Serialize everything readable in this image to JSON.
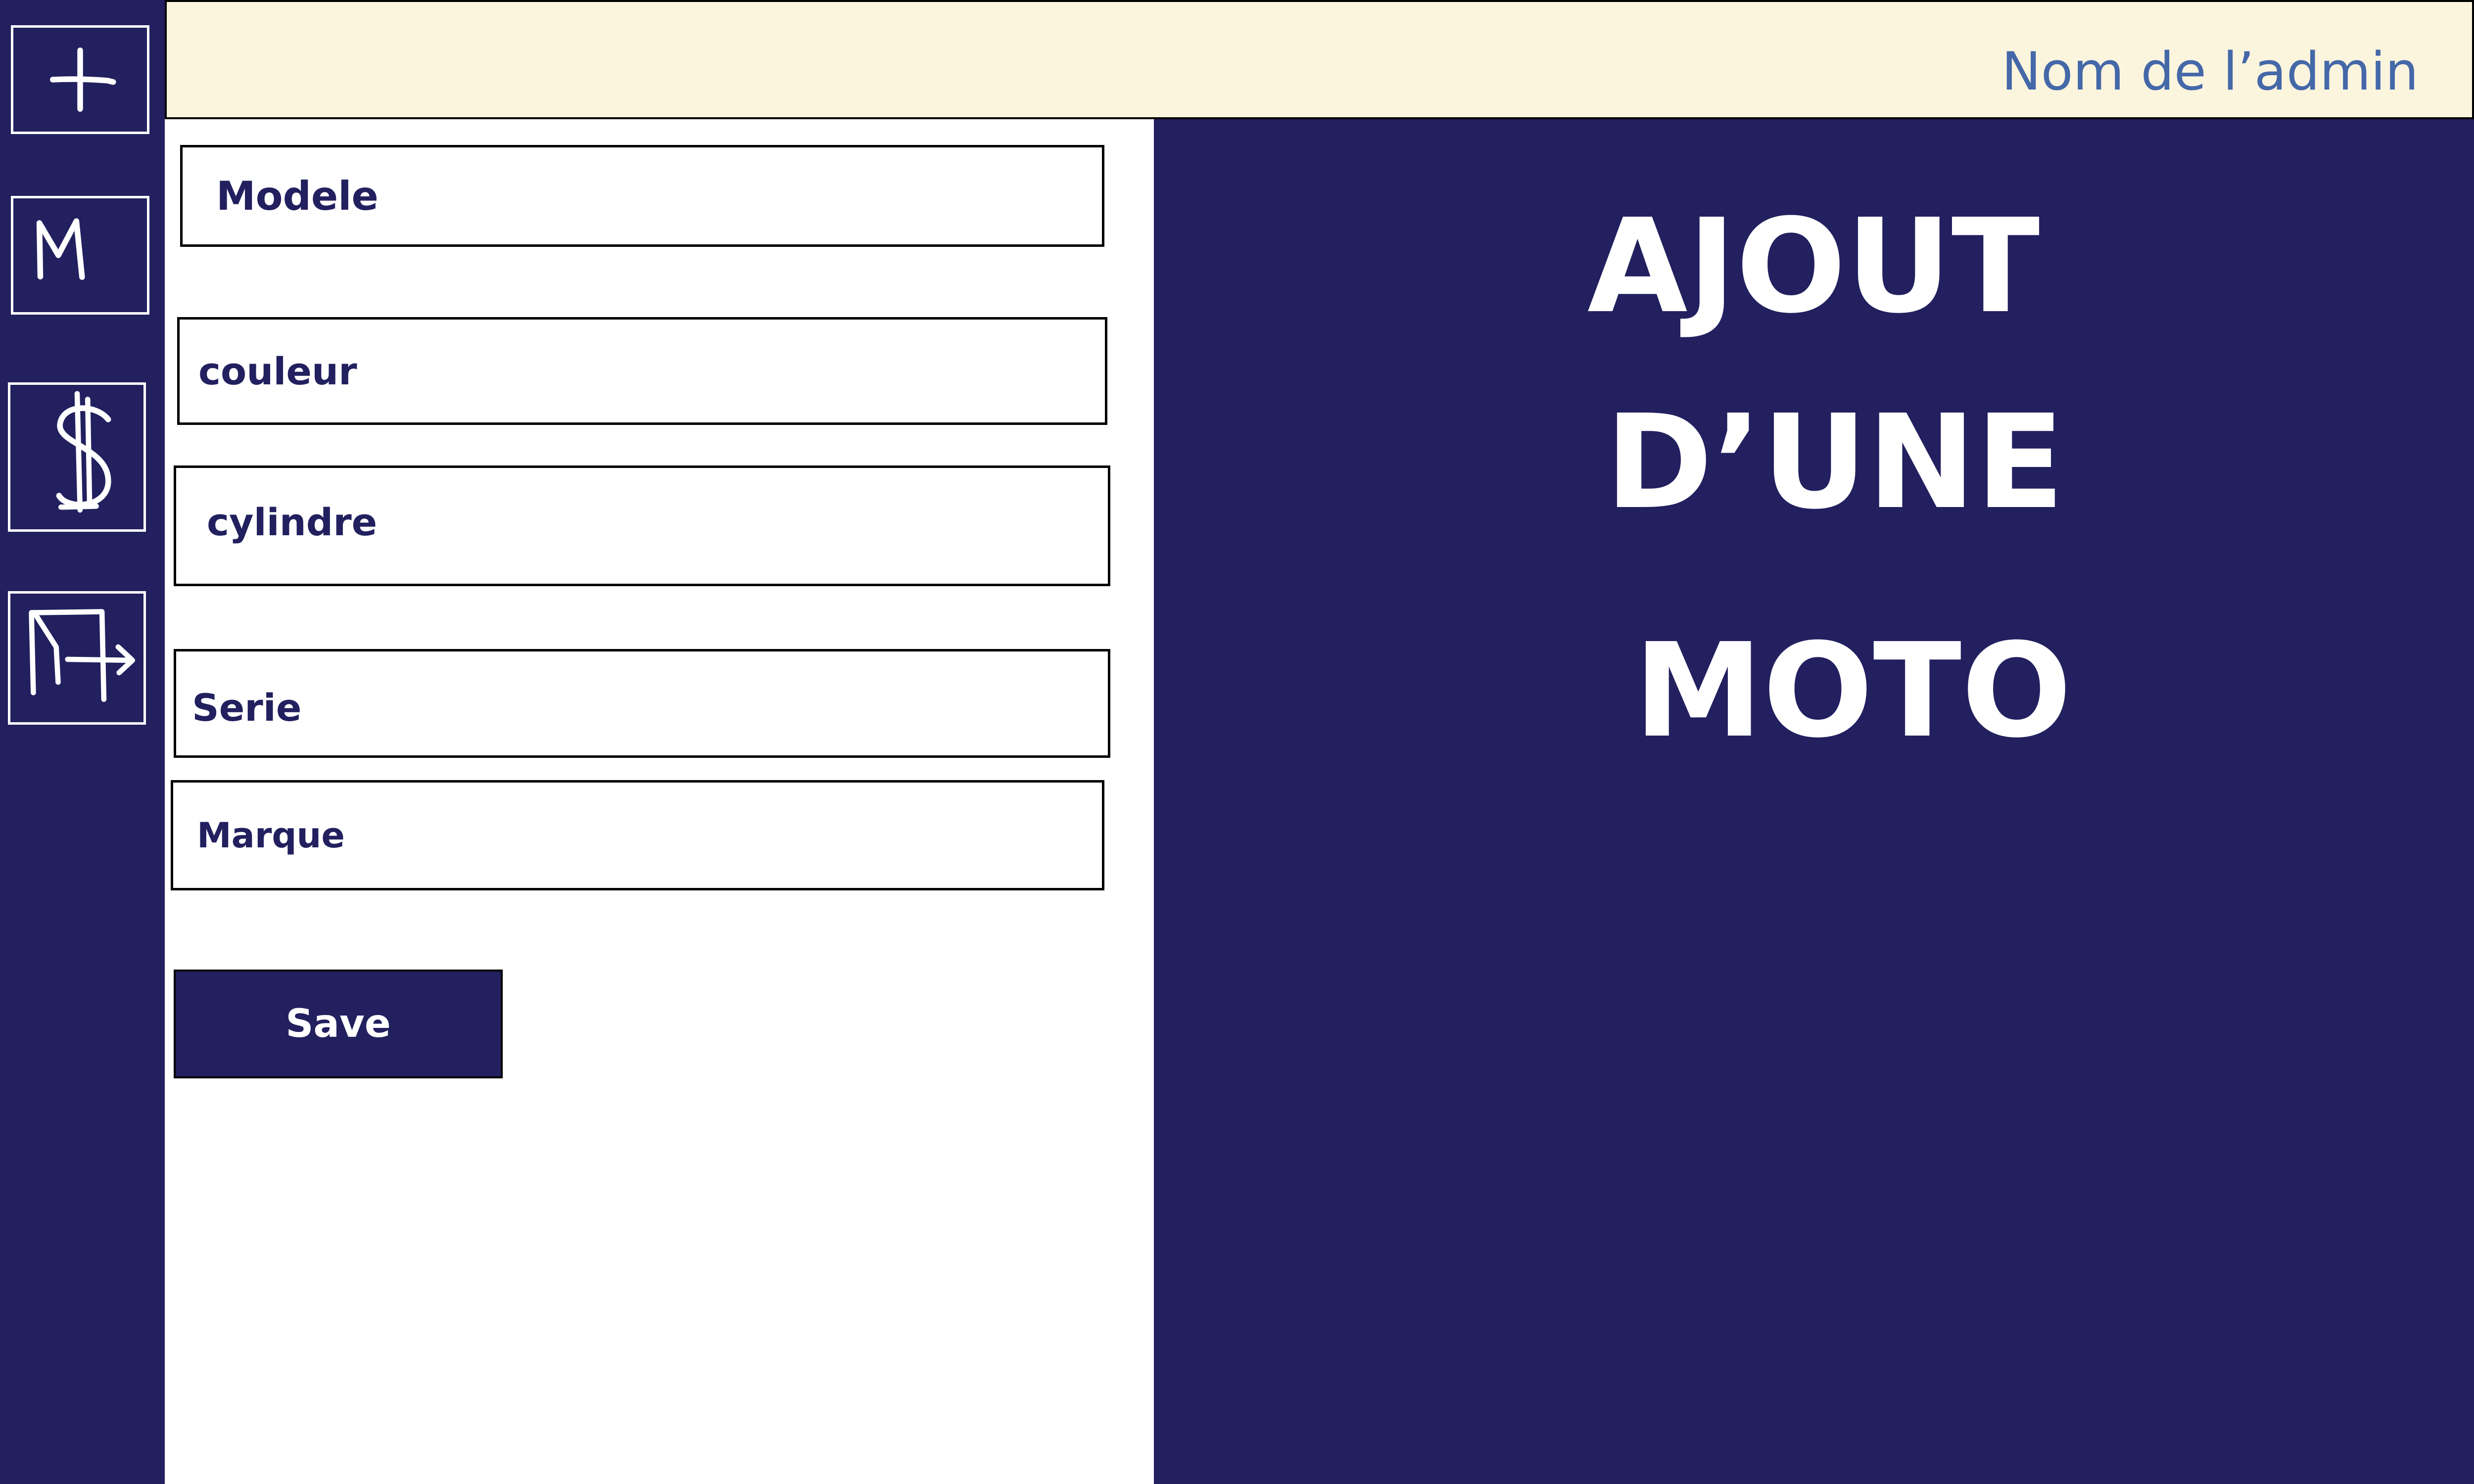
{
  "sidebar": {
    "items": [
      {
        "name": "add",
        "icon": "plus-icon"
      },
      {
        "name": "models",
        "icon": "letter-m-icon"
      },
      {
        "name": "price",
        "icon": "dollar-icon"
      },
      {
        "name": "logout",
        "icon": "logout-icon"
      }
    ]
  },
  "header": {
    "admin_name": "Nom de l’admin"
  },
  "form": {
    "modele_placeholder": "Modele",
    "couleur_placeholder": "couleur",
    "cylindre_placeholder": "cylindre",
    "serie_placeholder": "Serie",
    "marque_placeholder": "Marque",
    "save_label": "Save"
  },
  "hero": {
    "line1": "AJOUT",
    "line2": "D’UNE",
    "line3": "MOTO"
  },
  "colors": {
    "primary": "#22205f",
    "header_bg": "#fcf5de",
    "admin_text": "#4468a8",
    "white": "#ffffff"
  }
}
